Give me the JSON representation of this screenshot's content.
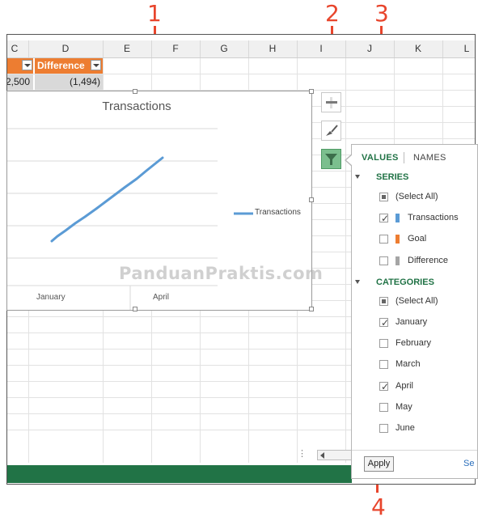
{
  "callouts": [
    "1",
    "2",
    "3",
    "4"
  ],
  "columns": [
    "C",
    "D",
    "E",
    "F",
    "G",
    "H",
    "I",
    "J",
    "K",
    "L"
  ],
  "table": {
    "header_label": "Difference",
    "row1_left": "2,500",
    "row1_right": "(1,494)"
  },
  "chart": {
    "title": "Transactions",
    "legend": "Transactions",
    "x_labels": [
      "January",
      "April"
    ]
  },
  "panel": {
    "tabs": {
      "values": "VALUES",
      "names": "NAMES"
    },
    "series_header": "SERIES",
    "series": [
      {
        "label": "(Select All)",
        "state": "partial"
      },
      {
        "label": "Transactions",
        "state": "checked",
        "color": "#5b9bd5"
      },
      {
        "label": "Goal",
        "state": "unchecked",
        "color": "#ed7d31"
      },
      {
        "label": "Difference",
        "state": "unchecked",
        "color": "#a5a5a5"
      }
    ],
    "categories_header": "CATEGORIES",
    "categories": [
      {
        "label": "(Select All)",
        "state": "partial"
      },
      {
        "label": "January",
        "state": "checked"
      },
      {
        "label": "February",
        "state": "unchecked"
      },
      {
        "label": "March",
        "state": "unchecked"
      },
      {
        "label": "April",
        "state": "checked"
      },
      {
        "label": "May",
        "state": "unchecked"
      },
      {
        "label": "June",
        "state": "unchecked"
      }
    ],
    "apply_label": "Apply",
    "select_data_label": "Se"
  },
  "watermark": "PanduanPraktis.com",
  "colors": {
    "accent": "#217346",
    "callout": "#e8452c",
    "table_header": "#ed7d31",
    "series_line": "#5b9bd5"
  }
}
